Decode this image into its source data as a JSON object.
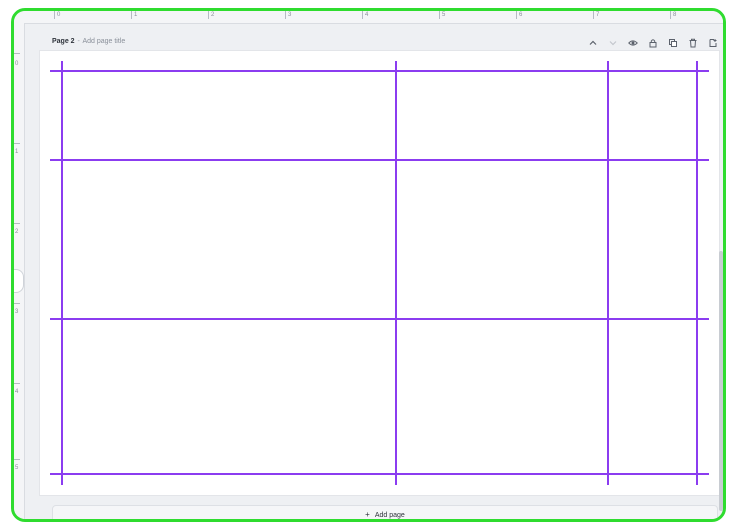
{
  "page_header": {
    "page_label": "Page 2",
    "separator": "-",
    "title_placeholder": "Add page title"
  },
  "header_icons": [
    "chevron-up-icon",
    "chevron-down-icon",
    "eye-icon",
    "lock-icon",
    "duplicate-icon",
    "trash-icon",
    "add-page-icon"
  ],
  "ruler": {
    "top_numbers": [
      "0",
      "1",
      "2",
      "3",
      "4",
      "5",
      "6",
      "7",
      "8"
    ],
    "left_numbers": [
      "0",
      "1",
      "2",
      "3",
      "4",
      "5"
    ]
  },
  "add_page": {
    "label": "Add page",
    "plus": "+"
  },
  "colors": {
    "frame_border": "#2fdc2f",
    "grid_lines": "#8b3cf0",
    "canvas_bg": "#ffffff",
    "workspace_bg": "#eef0f3"
  }
}
